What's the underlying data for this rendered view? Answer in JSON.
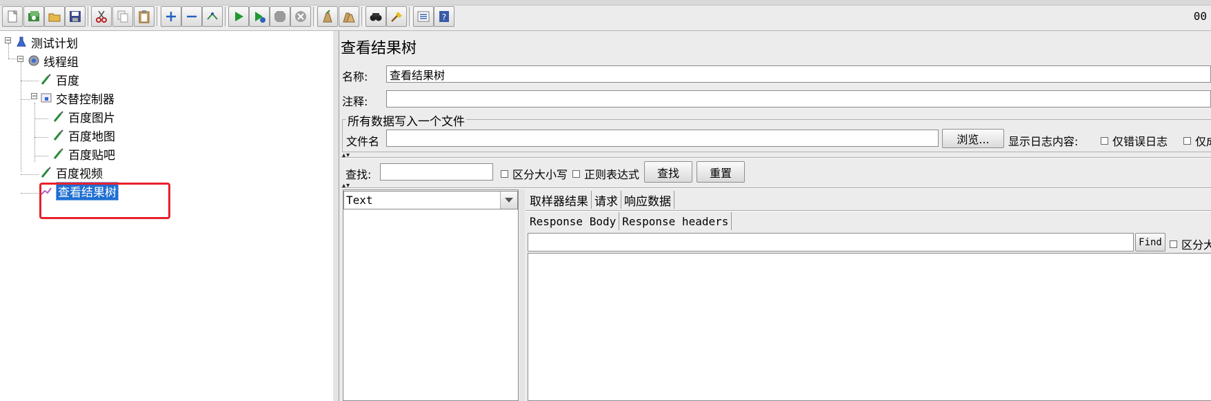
{
  "toolbar": {
    "buttons": [
      "new-icon",
      "templates-icon",
      "open-icon",
      "save-icon",
      "cut-icon",
      "copy-icon",
      "paste-icon",
      "expand-icon",
      "collapse-icon",
      "toggle-icon",
      "start-icon",
      "start-no-pause-icon",
      "stop-icon",
      "shutdown-icon",
      "clear-icon",
      "clear-all-icon",
      "search-icon",
      "reset-search-icon",
      "function-helper-icon",
      "help-icon"
    ],
    "elapsed": "00"
  },
  "tree": {
    "root": "测试计划",
    "thread_group": "线程组",
    "sampler_baidu": "百度",
    "controller": "交替控制器",
    "child1": "百度图片",
    "child2": "百度地图",
    "child3": "百度贴吧",
    "sampler_video": "百度视频",
    "listener": "查看结果树"
  },
  "panel": {
    "title": "查看结果树",
    "name_label": "名称:",
    "name_value": "查看结果树",
    "comment_label": "注释:",
    "comment_value": "",
    "file_group_title": "所有数据写入一个文件",
    "filename_label": "文件名",
    "browse_button": "浏览...",
    "log_display_label": "显示日志内容:",
    "errors_only": "仅错误日志",
    "success_only": "仅成"
  },
  "search": {
    "label": "查找:",
    "value": "",
    "case_sensitive": "区分大小写",
    "regex": "正则表达式",
    "find_button": "查找",
    "reset_button": "重置"
  },
  "results": {
    "renderer": "Text",
    "tabs": [
      "取样器结果",
      "请求",
      "响应数据"
    ],
    "subtabs": [
      "Response Body",
      "Response headers"
    ],
    "find_button": "Find",
    "find_case": "区分大"
  },
  "colors": {
    "selection": "#1f6fd2",
    "highlight_box": "#e8202a"
  }
}
